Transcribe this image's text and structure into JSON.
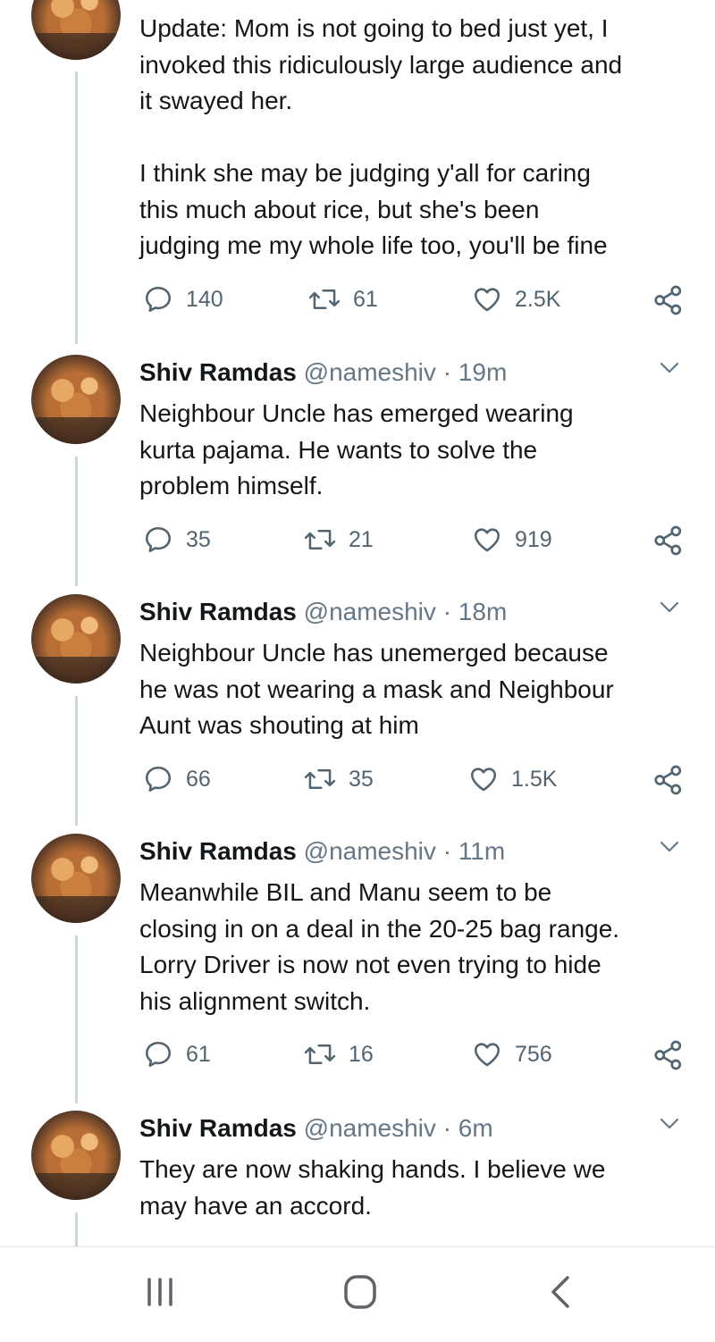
{
  "tweets": [
    {
      "text": "Update: Mom is not going to bed just yet, I\ninvoked this ridiculously large audience and\nit swayed her.\n\nI think she may be judging y'all for caring\nthis much about rice, but she's been\njudging me my whole life too, you'll be fine",
      "replies": "140",
      "retweets": "61",
      "likes": "2.5K"
    },
    {
      "name": "Shiv Ramdas",
      "handle": "@nameshiv",
      "time": "19m",
      "text": "Neighbour Uncle has emerged wearing\nkurta pajama. He wants to solve the\nproblem himself.",
      "replies": "35",
      "retweets": "21",
      "likes": "919"
    },
    {
      "name": "Shiv Ramdas",
      "handle": "@nameshiv",
      "time": "18m",
      "text": "Neighbour Uncle has unemerged because\nhe was not wearing a mask and Neighbour\nAunt was shouting at him",
      "replies": "66",
      "retweets": "35",
      "likes": "1.5K"
    },
    {
      "name": "Shiv Ramdas",
      "handle": "@nameshiv",
      "time": "11m",
      "text": "Meanwhile BIL and Manu seem to be\nclosing in on a deal in the 20-25 bag range.\nLorry Driver is now not even trying to hide\nhis alignment switch.",
      "replies": "61",
      "retweets": "16",
      "likes": "756"
    },
    {
      "name": "Shiv Ramdas",
      "handle": "@nameshiv",
      "time": "6m",
      "text": "They are now shaking hands. I believe we\nmay have an accord."
    }
  ],
  "header_separator": "·",
  "icons": {
    "reply": "reply-icon",
    "retweet": "retweet-icon",
    "like": "heart-icon",
    "share": "share-icon",
    "more": "chevron-down-icon",
    "nav_recents": "recent-apps-icon",
    "nav_home": "home-icon",
    "nav_back": "back-icon"
  },
  "colors": {
    "text": "#14171a",
    "secondary": "#657786",
    "thread_line": "#ccd6dd"
  }
}
